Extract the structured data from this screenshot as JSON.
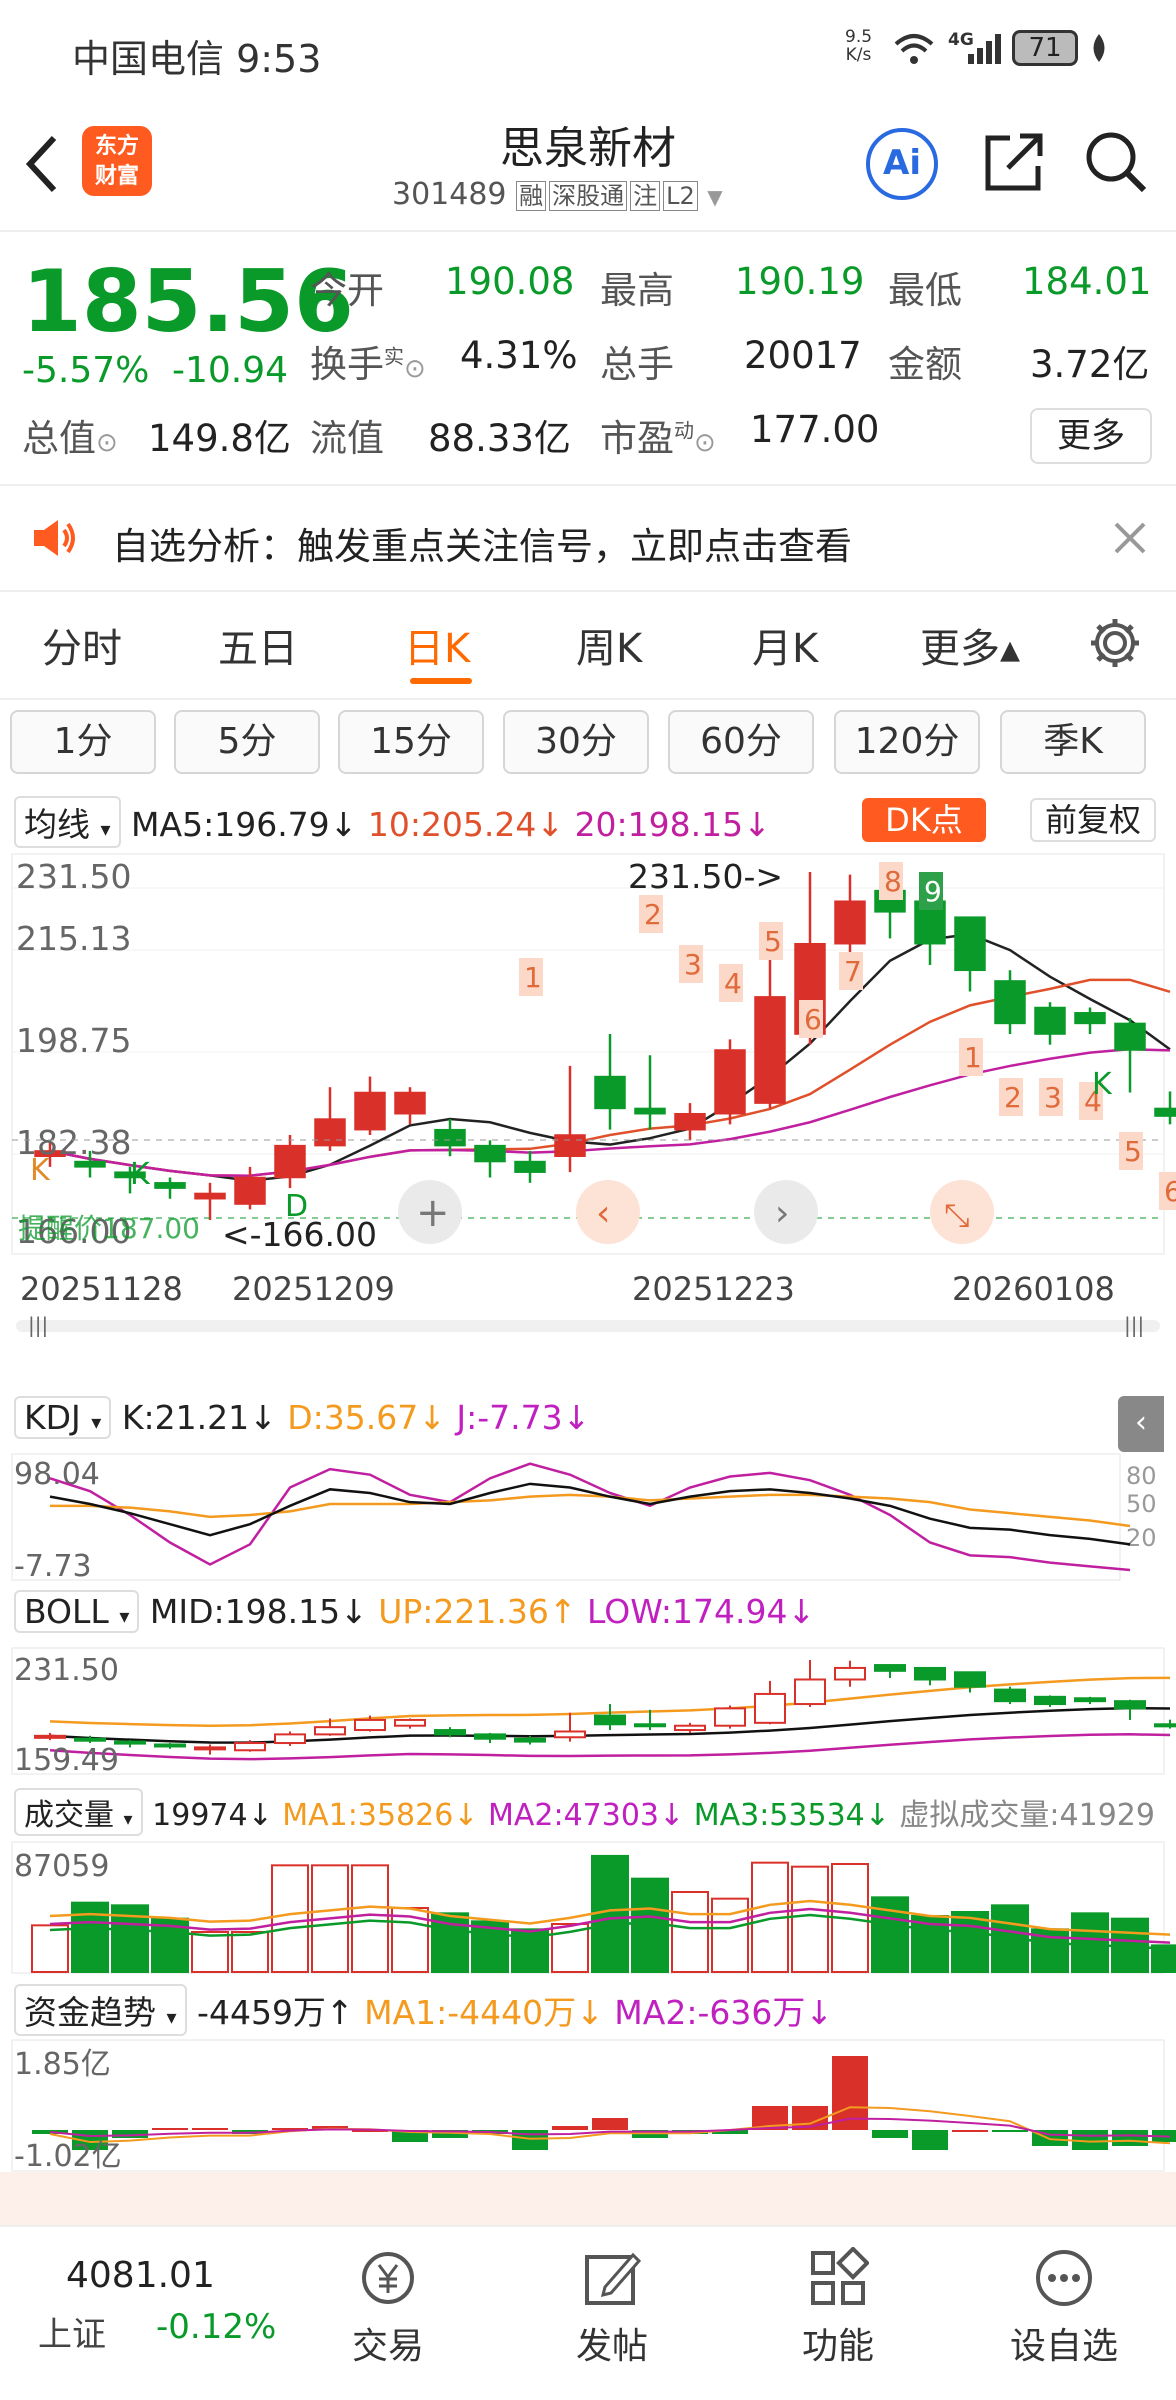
{
  "status": {
    "carrier": "中国电信 9:53",
    "net_speed_top": "9.5",
    "net_speed_bottom": "K/s",
    "signal": "4G",
    "battery": "71"
  },
  "header": {
    "name": "思泉新材",
    "code": "301489",
    "badges": [
      "融",
      "深股通",
      "注",
      "L2"
    ],
    "logo_line1": "东方",
    "logo_line2": "财富",
    "ai": "Ai"
  },
  "quote": {
    "price": "185.56",
    "change_pct": "-5.57%",
    "change": "-10.94",
    "open_label": "今开",
    "open": "190.08",
    "high_label": "最高",
    "high": "190.19",
    "low_label": "最低",
    "low": "184.01",
    "turnover_label": "换手",
    "turnover_sup": "实",
    "turnover": "4.31%",
    "vol_label": "总手",
    "vol": "20017",
    "amt_label": "金额",
    "amt": "3.72亿",
    "mcap_label": "总值",
    "mcap": "149.8亿",
    "float_label": "流值",
    "float": "88.33亿",
    "pe_label": "市盈",
    "pe_sup": "动",
    "pe": "177.00",
    "more": "更多"
  },
  "notice": {
    "text": "自选分析：触发重点关注信号，立即点击查看"
  },
  "tabs": [
    "分时",
    "五日",
    "日K",
    "周K",
    "月K",
    "更多▴"
  ],
  "periods": [
    "1分",
    "5分",
    "15分",
    "30分",
    "60分",
    "120分",
    "季K"
  ],
  "ma": {
    "selector": "均线",
    "ma5": "MA5:196.79↓",
    "ma10": "10:205.24↓",
    "ma20": "20:198.15↓",
    "dk": "DK点",
    "fq": "前复权"
  },
  "kline": {
    "y_labels": [
      "231.50",
      "215.13",
      "198.75",
      "182.38",
      "166.00"
    ],
    "x_labels": [
      "20251128",
      "20251209",
      "20251223",
      "20260108"
    ],
    "high_annot": "231.50->",
    "low_annot": "<-166.00",
    "remind": "提醒价187.00",
    "signals_left": [
      "1",
      "2",
      "3",
      "4",
      "5",
      "6",
      "7",
      "8",
      "9"
    ],
    "signals_right": [
      "1",
      "2",
      "3",
      "4",
      "5",
      "6"
    ],
    "k_markers": [
      "K",
      "K",
      "D"
    ]
  },
  "kdj": {
    "selector": "KDJ",
    "k": "K:21.21↓",
    "d": "D:35.67↓",
    "j": "J:-7.73↓",
    "top": "98.04",
    "bottom": "-7.73",
    "levels": [
      "80",
      "50",
      "20"
    ]
  },
  "boll": {
    "selector": "BOLL",
    "mid": "MID:198.15↓",
    "up": "UP:221.36↑",
    "low": "LOW:174.94↓",
    "top": "231.50",
    "bottom": "159.49"
  },
  "volume": {
    "selector": "成交量",
    "v": "19974↓",
    "ma1": "MA1:35826↓",
    "ma2": "MA2:47303↓",
    "ma3": "MA3:53534↓",
    "virtual": "虚拟成交量:41929",
    "top": "87059"
  },
  "fund": {
    "selector": "资金趋势",
    "v": "-4459万↑",
    "ma1": "MA1:-4440万↓",
    "ma2": "MA2:-636万↓",
    "top": "1.85亿",
    "bottom": "-1.02亿"
  },
  "bottom_nav": {
    "index_value": "4081.01",
    "index_name": "上证",
    "index_change": "-0.12%",
    "items": [
      "交易",
      "发帖",
      "功能",
      "设自选"
    ]
  },
  "colors": {
    "up": "#d9302a",
    "down": "#0a9a2a",
    "accent": "#ff6a00",
    "ma10": "#e0502a",
    "ma20": "#c020a0"
  },
  "chart_data": {
    "type": "candlestick",
    "dates": [
      "20251128",
      "1201",
      "1202",
      "1203",
      "1204",
      "1205",
      "1208",
      "1209",
      "1210",
      "1211",
      "1212",
      "1215",
      "1216",
      "1217",
      "1218",
      "1219",
      "1222",
      "20251223",
      "1224",
      "1225",
      "1226",
      "1229",
      "1230",
      "1231",
      "0105",
      "0106",
      "0107",
      "20260108",
      "0109"
    ],
    "open": [
      178,
      177,
      175,
      173,
      170,
      169,
      174,
      180,
      183,
      186,
      183,
      180,
      177,
      178,
      193,
      187,
      183,
      186,
      188,
      201,
      218,
      228,
      226,
      223,
      211,
      206,
      205,
      203,
      187
    ],
    "close": [
      179,
      176,
      174,
      172,
      171,
      174,
      180,
      185,
      190,
      190,
      180,
      177,
      175,
      182,
      187,
      186,
      186,
      198,
      208,
      218,
      226,
      224,
      218,
      213,
      203,
      201,
      203,
      198,
      185.56
    ],
    "high": [
      181,
      179,
      176,
      174,
      173,
      176,
      182,
      191,
      193,
      191,
      185,
      181,
      179,
      195,
      201,
      197,
      188,
      200,
      217,
      231.5,
      231,
      226,
      226,
      223,
      213,
      207,
      206,
      204,
      190.19
    ],
    "low": [
      176,
      174,
      171,
      170,
      166,
      168,
      172,
      179,
      182,
      184,
      178,
      174,
      173,
      175,
      183,
      183,
      181,
      184,
      187,
      199,
      213,
      219,
      214,
      209,
      201,
      199,
      201,
      190,
      184.01
    ],
    "ylim": [
      166,
      231.5
    ]
  }
}
